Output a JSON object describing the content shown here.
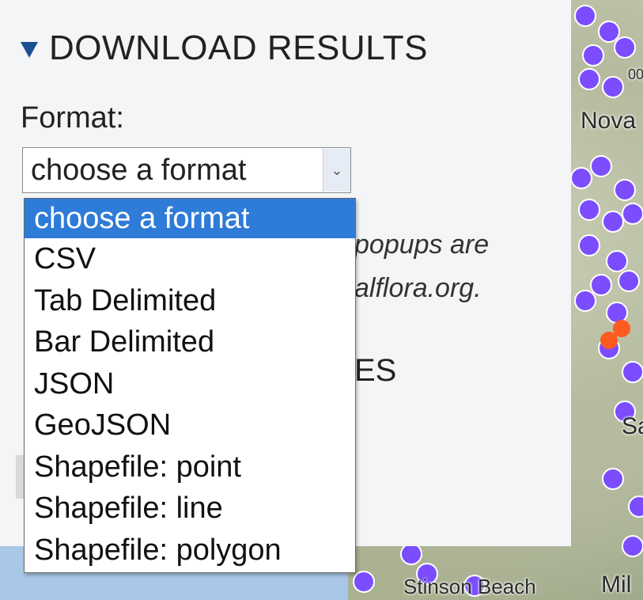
{
  "section": {
    "title": "DOWNLOAD RESULTS",
    "collapse_icon": "triangle-down-icon"
  },
  "format": {
    "label": "Format:",
    "selected": "choose a format",
    "options": [
      "choose a format",
      "CSV",
      "Tab Delimited",
      "Bar Delimited",
      "JSON",
      "GeoJSON",
      "Shapefile: point",
      "Shapefile: line",
      "Shapefile: polygon"
    ]
  },
  "partially_hidden": {
    "note_line1": "popups are",
    "note_line2": "alflora.org.",
    "heading_fragment": "ES"
  },
  "map": {
    "labels": [
      "Nova",
      "Sa",
      "Stinson Beach",
      "Mil",
      "00"
    ]
  },
  "colors": {
    "accent": "#1b4f95",
    "selected_option": "#2f7bd8",
    "map_marker": "#7b4dff",
    "map_marker_alt": "#ff5a1f"
  }
}
